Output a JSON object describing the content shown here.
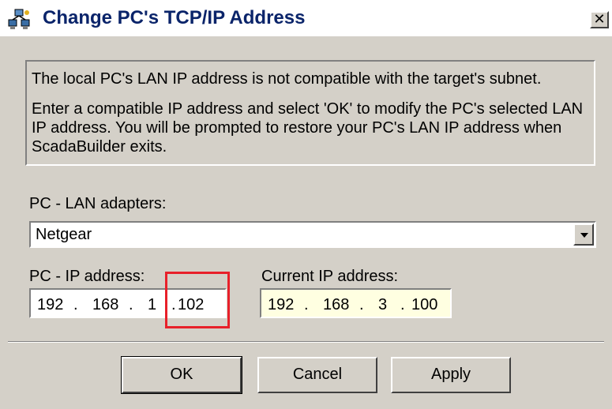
{
  "dialog": {
    "title": "Change PC's TCP/IP Address",
    "close_glyph": "✕",
    "title_icon": "network-icon"
  },
  "message": {
    "line1": "The local PC's LAN IP address is not compatible with the target's subnet.",
    "line2": "Enter a compatible IP address and select 'OK' to modify the PC's selected LAN IP address. You will be prompted to restore your PC's LAN IP address when ScadaBuilder exits."
  },
  "adapters": {
    "label": "PC - LAN adapters:",
    "selected": "Netgear"
  },
  "pc_ip": {
    "label": "PC - IP address:",
    "octet1": "192",
    "octet2": "168",
    "octet3": "1",
    "octet4": "102",
    "dot": "."
  },
  "current_ip": {
    "label": "Current IP address:",
    "octet1": "192",
    "octet2": "168",
    "octet3": "3",
    "octet4": "100",
    "dot": "."
  },
  "buttons": {
    "ok": "OK",
    "cancel": "Cancel",
    "apply": "Apply"
  },
  "colors": {
    "title_text": "#0a246a",
    "dialog_bg": "#d4d0c8",
    "readonly_field_bg": "#ffffe1",
    "highlight_box": "#e8202a"
  }
}
